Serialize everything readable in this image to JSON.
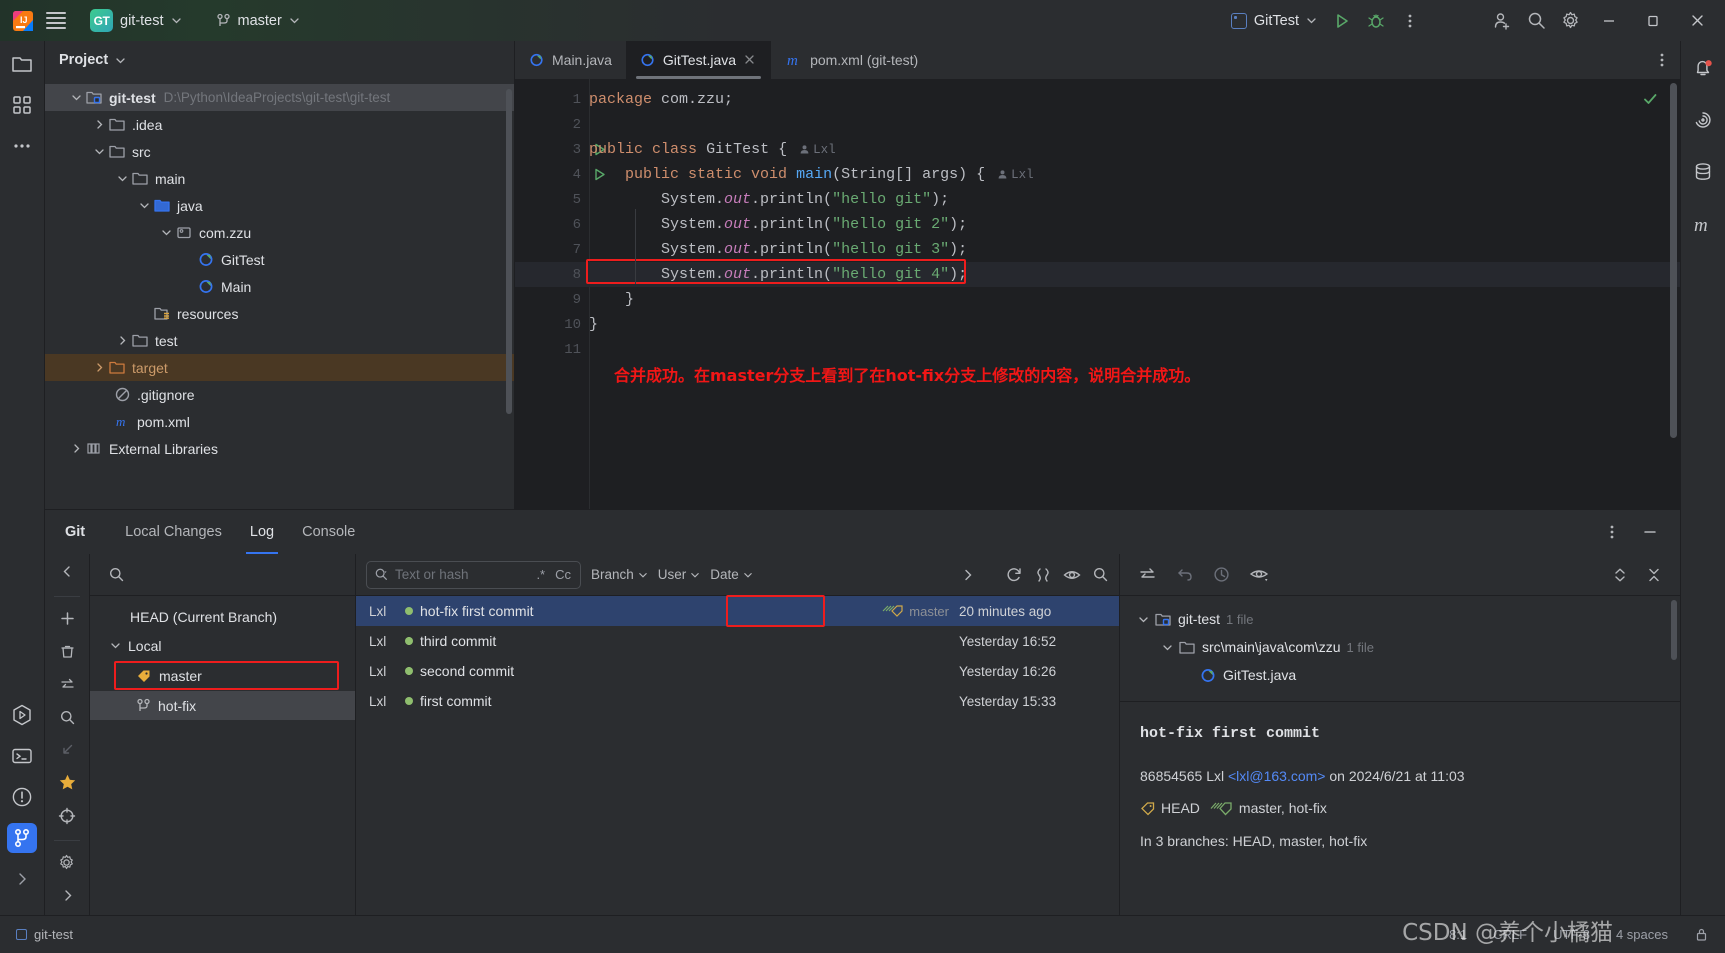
{
  "titlebar": {
    "project_badge": "GT",
    "project_name": "git-test",
    "branch_name": "master",
    "run_config": "GitTest",
    "icons": [
      "menu-icon",
      "project-chevron",
      "branch-icon",
      "branch-chevron",
      "run-icon",
      "debug-icon",
      "more-icon",
      "add-collaborator-icon",
      "search-everywhere-icon",
      "settings-icon",
      "minimize-icon",
      "maximize-icon",
      "close-icon"
    ]
  },
  "project_panel": {
    "title": "Project",
    "tree": [
      {
        "label": "git-test",
        "path": "D:\\Python\\IdeaProjects\\git-test\\git-test",
        "depth": 0,
        "twist": "down",
        "icon": "module-icon",
        "bold": true,
        "selected": true
      },
      {
        "label": ".idea",
        "depth": 1,
        "twist": "right",
        "icon": "folder-icon"
      },
      {
        "label": "src",
        "depth": 1,
        "twist": "down",
        "icon": "folder-icon"
      },
      {
        "label": "main",
        "depth": 2,
        "twist": "down",
        "icon": "folder-icon"
      },
      {
        "label": "java",
        "depth": 3,
        "twist": "down",
        "icon": "source-folder-icon"
      },
      {
        "label": "com.zzu",
        "depth": 4,
        "twist": "down",
        "icon": "package-icon"
      },
      {
        "label": "GitTest",
        "depth": 5,
        "twist": "",
        "icon": "java-class-runnable-icon"
      },
      {
        "label": "Main",
        "depth": 5,
        "twist": "",
        "icon": "java-class-runnable-icon"
      },
      {
        "label": "resources",
        "depth": 3,
        "twist": "",
        "icon": "resources-folder-icon"
      },
      {
        "label": "test",
        "depth": 2,
        "twist": "right",
        "icon": "folder-icon"
      },
      {
        "label": "target",
        "depth": 1,
        "twist": "right",
        "icon": "excluded-folder-icon",
        "orange": true,
        "highlight": true
      },
      {
        "label": ".gitignore",
        "depth": 1,
        "twist": "",
        "icon": "gitignore-icon"
      },
      {
        "label": "pom.xml",
        "depth": 1,
        "twist": "",
        "icon": "maven-icon"
      },
      {
        "label": "External Libraries",
        "depth": 0,
        "twist": "right",
        "icon": "libraries-icon"
      }
    ]
  },
  "editor": {
    "tabs": [
      {
        "label": "Main.java",
        "icon": "java-class-runnable-icon",
        "active": false,
        "closable": false
      },
      {
        "label": "GitTest.java",
        "icon": "java-class-runnable-icon",
        "active": true,
        "closable": true
      },
      {
        "label": "pom.xml (git-test)",
        "icon": "maven-icon",
        "active": false,
        "closable": false
      }
    ],
    "lines": [
      {
        "no": "1",
        "run": false
      },
      {
        "no": "2",
        "run": false
      },
      {
        "no": "3",
        "run": true
      },
      {
        "no": "4",
        "run": true
      },
      {
        "no": "5",
        "run": false
      },
      {
        "no": "6",
        "run": false
      },
      {
        "no": "7",
        "run": false
      },
      {
        "no": "8",
        "run": false
      },
      {
        "no": "9",
        "run": false
      },
      {
        "no": "10",
        "run": false
      },
      {
        "no": "11",
        "run": false
      }
    ],
    "code": {
      "l1_kw": "package",
      "l1_rest": " com.zzu;",
      "l3_kw1": "public",
      "l3_kw2": "class",
      "l3_name": "GitTest",
      "l3_brace": "{",
      "l3_author": "Lxl",
      "l4_kw": "public static void",
      "l4_main": "main",
      "l4_args": "(String[] args) {",
      "l4_author": "Lxl",
      "l5_sys": "System.",
      "l5_out": "out",
      "l5_call": ".println(",
      "l5_str": "\"hello git\"",
      "l5_end": ");",
      "l6_str": "\"hello git 2\"",
      "l7_str": "\"hello git 3\"",
      "l8_str": "\"hello git 4\"",
      "l9_brace": "}",
      "l10_brace": "}"
    },
    "annotation": "合并成功。在master分支上看到了在hot-fix分支上修改的内容，说明合并成功。",
    "annotation_color": "#f21616"
  },
  "git_tool": {
    "title": "Git",
    "tabs": [
      {
        "label": "Local Changes",
        "active": false
      },
      {
        "label": "Log",
        "active": true
      },
      {
        "label": "Console",
        "active": false
      }
    ],
    "branches": {
      "head_label": "HEAD (Current Branch)",
      "local_label": "Local",
      "items": [
        {
          "label": "master",
          "icon": "tag-icon",
          "boxed": true,
          "selected": false
        },
        {
          "label": "hot-fix",
          "icon": "branch-icon",
          "boxed": false,
          "selected": true
        }
      ]
    },
    "log_toolbar": {
      "search_placeholder": "Text or hash",
      "regex_label": ".*",
      "case_label": "Cc",
      "filters": [
        "Branch",
        "User",
        "Date"
      ],
      "icons": [
        "refresh-icon",
        "intellisort-icon",
        "show-details-icon",
        "search-icon",
        "expand-icon"
      ]
    },
    "commits": [
      {
        "user": "Lxl",
        "message": "hot-fix first commit",
        "ref": "master",
        "date": "20 minutes ago",
        "selected": true,
        "ref_boxed": true
      },
      {
        "user": "Lxl",
        "message": "third commit",
        "ref": "",
        "date": "Yesterday 16:52",
        "selected": false,
        "ref_boxed": false
      },
      {
        "user": "Lxl",
        "message": "second commit",
        "ref": "",
        "date": "Yesterday 16:26",
        "selected": false,
        "ref_boxed": false
      },
      {
        "user": "Lxl",
        "message": "first commit",
        "ref": "",
        "date": "Yesterday 15:33",
        "selected": false,
        "ref_boxed": false
      }
    ],
    "details": {
      "toolbar_icons": [
        "show-diff-icon",
        "revert-icon",
        "history-icon",
        "preview-icon",
        "expand-collapse-icon",
        "collapse-all-icon"
      ],
      "changes": [
        {
          "label": "git-test",
          "count": "1 file",
          "depth": 0,
          "icon": "module-icon",
          "twist": "down"
        },
        {
          "label": "src\\main\\java\\com\\zzu",
          "count": "1 file",
          "depth": 1,
          "icon": "folder-icon",
          "twist": "down"
        },
        {
          "label": "GitTest.java",
          "count": "",
          "depth": 2,
          "icon": "java-class-runnable-icon",
          "twist": ""
        }
      ],
      "subject": "hot-fix first commit",
      "hash": "86854565",
      "author": "Lxl",
      "email": "<lxl@163.com>",
      "on_text": "on 2024/6/21 at 11:03",
      "refs": [
        {
          "label": "HEAD",
          "icon": "tag-icon-yellow"
        },
        {
          "label": "master, hot-fix",
          "icon": "tag-icon-green"
        }
      ],
      "branches_line": "In 3 branches: HEAD, master, hot-fix"
    }
  },
  "statusbar": {
    "project": "git-test",
    "caret": "8:1",
    "line_separator": "CRLF",
    "encoding": "UTF-8",
    "indent": "4 spaces",
    "watermark": "CSDN @养个小橘猫"
  }
}
